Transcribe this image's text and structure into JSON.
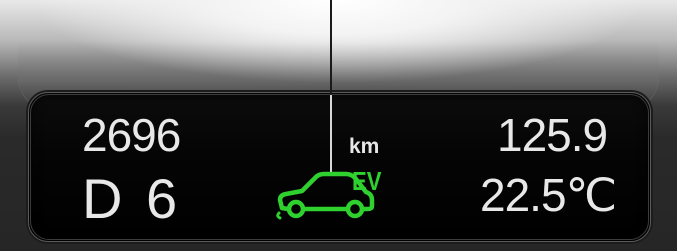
{
  "display": {
    "odometer": "2696",
    "gear": "D 6",
    "unit": "km",
    "trip": "125.9",
    "temperature": "22.5℃",
    "ev_label": "EV"
  },
  "icons": {
    "car": "car-icon"
  },
  "colors": {
    "ev_green": "#2fd12f",
    "text": "#e8e8e8",
    "screen": "#000000"
  }
}
